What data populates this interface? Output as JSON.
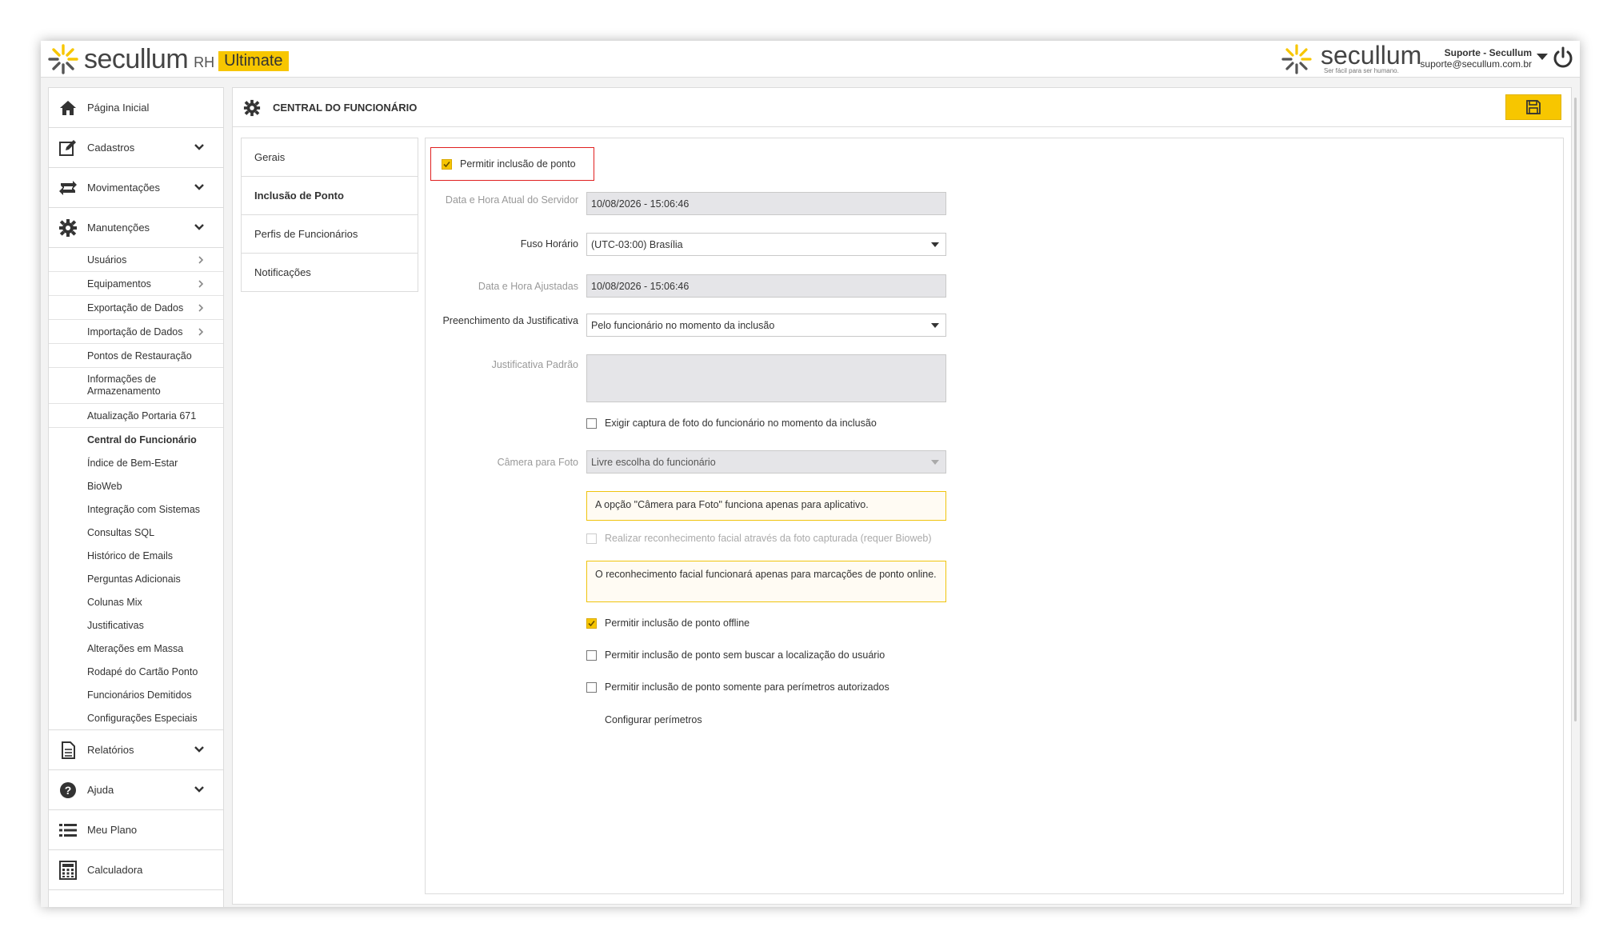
{
  "header": {
    "brand": "secullum",
    "brand_suffix": "RH",
    "edition": "Ultimate",
    "partner_brand": "secullum",
    "partner_tagline": "Ser fácil para ser humano.",
    "user_name": "Suporte - Secullum",
    "user_email": "suporte@secullum.com.br"
  },
  "sidebar": {
    "main_top": [
      {
        "label": "Página Inicial",
        "icon": "home-icon"
      },
      {
        "label": "Cadastros",
        "icon": "edit-icon",
        "expandable": true
      },
      {
        "label": "Movimentações",
        "icon": "exchange-icon",
        "expandable": true
      },
      {
        "label": "Manutenções",
        "icon": "gear-icon",
        "expandable": true
      }
    ],
    "sub_items": [
      {
        "label": "Usuários",
        "submenu": true
      },
      {
        "label": "Equipamentos",
        "submenu": true
      },
      {
        "label": "Exportação de Dados",
        "submenu": true
      },
      {
        "label": "Importação de Dados",
        "submenu": true
      },
      {
        "label": "Pontos de Restauração"
      },
      {
        "label": "Informações de Armazenamento"
      },
      {
        "label": "Atualização Portaria 671"
      },
      {
        "label": "Central do Funcionário",
        "active": true
      },
      {
        "label": "Índice de Bem-Estar"
      },
      {
        "label": "BioWeb"
      },
      {
        "label": "Integração com Sistemas"
      },
      {
        "label": "Consultas SQL"
      },
      {
        "label": "Histórico de Emails"
      },
      {
        "label": "Perguntas Adicionais"
      },
      {
        "label": "Colunas Mix"
      },
      {
        "label": "Justificativas"
      },
      {
        "label": "Alterações em Massa"
      },
      {
        "label": "Rodapé do Cartão Ponto"
      },
      {
        "label": "Funcionários Demitidos"
      },
      {
        "label": "Configurações Especiais"
      }
    ],
    "main_bottom": [
      {
        "label": "Relatórios",
        "icon": "document-icon",
        "expandable": true
      },
      {
        "label": "Ajuda",
        "icon": "help-icon",
        "expandable": true
      },
      {
        "label": "Meu Plano",
        "icon": "list-icon"
      },
      {
        "label": "Calculadora",
        "icon": "calculator-icon"
      }
    ]
  },
  "page": {
    "title": "CENTRAL DO FUNCIONÁRIO",
    "save_icon": "save-icon"
  },
  "tabs": [
    "Gerais",
    "Inclusão de Ponto",
    "Perfis de Funcionários",
    "Notificações"
  ],
  "active_tab": "Inclusão de Ponto",
  "form": {
    "allow_inclusion_label": "Permitir inclusão de ponto",
    "allow_inclusion_checked": true,
    "server_datetime_label": "Data e Hora Atual do Servidor",
    "server_datetime_value": "10/08/2026 - 15:06:46",
    "timezone_label": "Fuso Horário",
    "timezone_value": "(UTC-03:00) Brasília",
    "adjusted_datetime_label": "Data e Hora Ajustadas",
    "adjusted_datetime_value": "10/08/2026 - 15:06:46",
    "justification_fill_label": "Preenchimento da Justificativa",
    "justification_fill_value": "Pelo funcionário no momento da inclusão",
    "default_justification_label": "Justificativa Padrão",
    "default_justification_value": "",
    "require_photo_label": "Exigir captura de foto do funcionário no momento da inclusão",
    "require_photo_checked": false,
    "camera_label": "Câmera para Foto",
    "camera_value": "Livre escolha do funcionário",
    "camera_warning": "A opção \"Câmera para Foto\" funciona apenas para aplicativo.",
    "facial_label": "Realizar reconhecimento facial através da foto capturada (requer Bioweb)",
    "facial_checked": false,
    "facial_warning": "O reconhecimento facial funcionará apenas para marcações de ponto online.",
    "offline_label": "Permitir inclusão de ponto offline",
    "offline_checked": true,
    "no_location_label": "Permitir inclusão de ponto sem buscar a localização do usuário",
    "no_location_checked": false,
    "perimeters_only_label": "Permitir inclusão de ponto somente para perímetros autorizados",
    "perimeters_only_checked": false,
    "configure_perimeters_link": "Configurar perímetros"
  },
  "colors": {
    "accent": "#f7c600",
    "highlight_border": "#e02020",
    "warning_border": "#f0c40e"
  }
}
